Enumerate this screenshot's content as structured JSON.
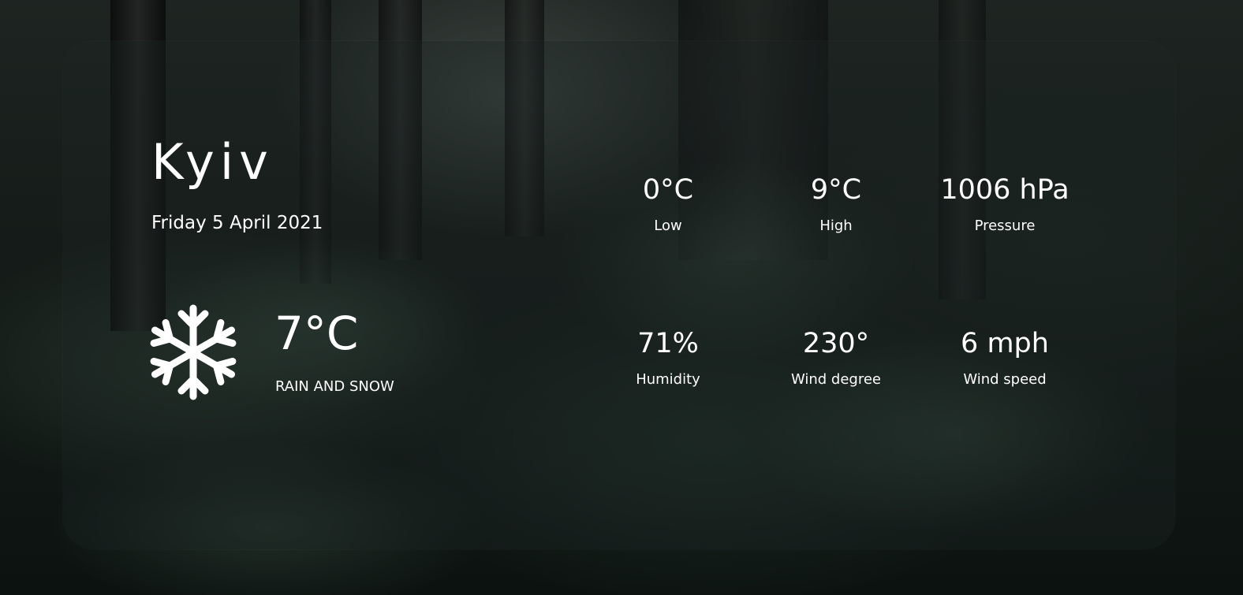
{
  "location": {
    "city": "Kyiv",
    "date": "Friday 5 April 2021"
  },
  "current": {
    "icon": "snowflake-icon",
    "temperature": "7°C",
    "condition": "RAIN AND SNOW"
  },
  "stats": [
    {
      "value": "0°C",
      "label": "Low"
    },
    {
      "value": "9°C",
      "label": "High"
    },
    {
      "value": "1006 hPa",
      "label": "Pressure"
    },
    {
      "value": "71%",
      "label": "Humidity"
    },
    {
      "value": "230°",
      "label": "Wind degree"
    },
    {
      "value": "6 mph",
      "label": "Wind speed"
    }
  ]
}
